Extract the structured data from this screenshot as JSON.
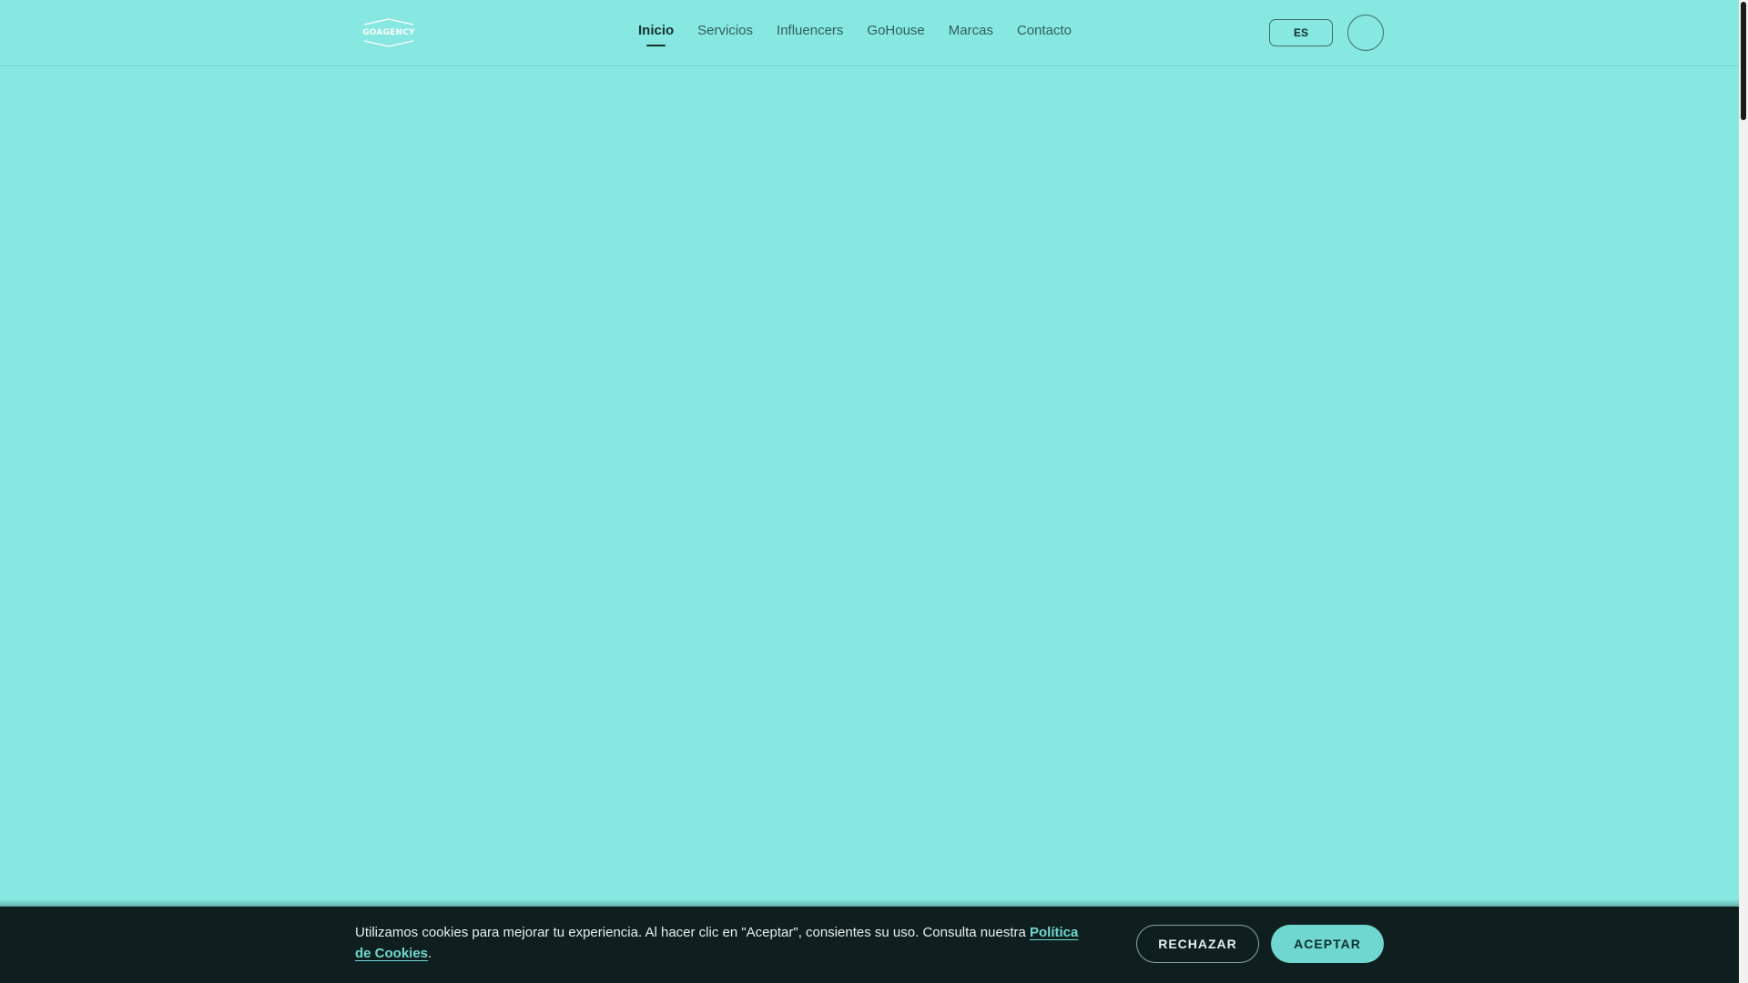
{
  "header": {
    "logo_text": "GOAGENCY",
    "nav": [
      {
        "label": "Inicio",
        "active": true
      },
      {
        "label": "Servicios",
        "active": false
      },
      {
        "label": "Influencers",
        "active": false
      },
      {
        "label": "GoHouse",
        "active": false
      },
      {
        "label": "Marcas",
        "active": false
      },
      {
        "label": "Contacto",
        "active": false
      }
    ],
    "language": {
      "code": "ES",
      "left_icon": "globe-icon",
      "right_icon": "chevron-down-icon",
      "left_glyph": "",
      "right_glyph": ""
    },
    "action_button": {
      "icon": "user-icon",
      "glyph": ""
    }
  },
  "cookie_banner": {
    "text": "Utilizamos cookies para mejorar tu experiencia. Al hacer clic en \"Aceptar\", consientes su uso. Consulta nuestra ",
    "link_text": "Política de Cookies",
    "text_end": ".",
    "reject_label": "RECHAZAR",
    "accept_label": "ACEPTAR"
  },
  "colors": {
    "background": "#87e8e1",
    "cookie_bar": "#0f1f1f",
    "accent": "#6fd7cf"
  }
}
